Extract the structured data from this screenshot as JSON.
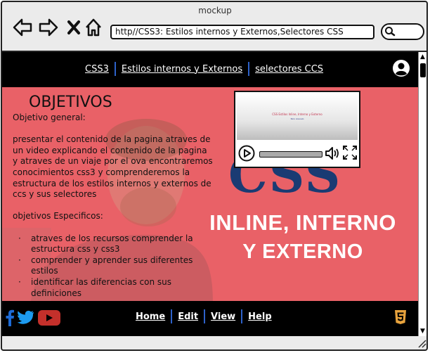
{
  "window": {
    "title": "mockup"
  },
  "browser": {
    "url": "http//CSS3: Estilos internos y Externos,Selectores CSS"
  },
  "topnav": {
    "items": [
      "CSS3",
      "Estilos internos y Externos",
      "selectores CCS"
    ]
  },
  "hero": {
    "css_text": "CSS",
    "banner_line1": "INLINE, INTERNO",
    "banner_line2": "Y EXTERNO"
  },
  "content": {
    "title": "OBJETIVOS",
    "general_label": "Objetivo general:",
    "general_text": "presentar el contenido de la pagina atraves de un video explicando el contenido de la pagina y atraves de un viaje por el ova encontraremos conocimientos css3 y comprenderemos la estructura de los estilos internos y externos de ccs y sus selectores",
    "specific_label": "objetivos Especificos:",
    "specific_items": [
      "atraves de los recursos comprender la estructura css y css3",
      "comprender y aprender sus diferentes estilos",
      "identificar las diferencias con sus definiciones"
    ]
  },
  "video": {
    "caption": "CSS Estilos Inline, Interno y Externo",
    "caption2": "Nico Arevalo"
  },
  "footer": {
    "links": [
      "Home",
      "Edit",
      "View",
      "Help"
    ]
  },
  "colors": {
    "hero_bg": "#e96167",
    "bar_bg": "#000000",
    "nav_separator": "#2d61c9",
    "html5_orange": "#e8a33d",
    "youtube_red": "#c4302b",
    "social_blue": "#1d9bf0"
  }
}
